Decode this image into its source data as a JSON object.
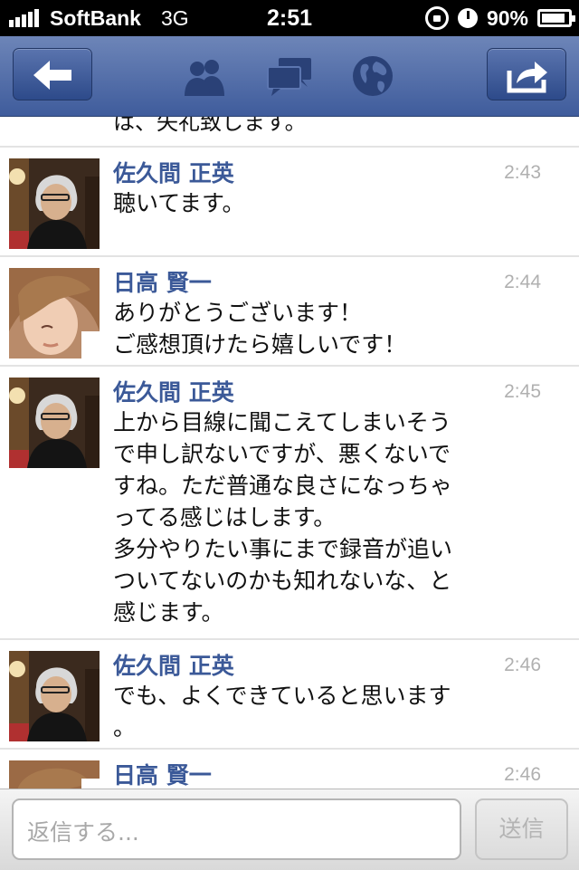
{
  "status_bar": {
    "carrier": "SoftBank",
    "network": "3G",
    "time": "2:51",
    "battery_percent": "90%",
    "battery_level": 0.9
  },
  "nav": {
    "back_icon": "back-arrow-icon",
    "friends_icon": "friends-icon",
    "messages_icon": "messages-icon",
    "globe_icon": "globe-icon",
    "share_icon": "share-icon"
  },
  "conversation": {
    "clipped_top_text": "は、失礼致します。",
    "messages": [
      {
        "sender": "佐久間 正英",
        "time": "2:43",
        "text": "聴いてます。"
      },
      {
        "sender": "日高 賢一",
        "time": "2:44",
        "text": "ありがとうございます！\nご感想頂けたら嬉しいです！"
      },
      {
        "sender": "佐久間 正英",
        "time": "2:45",
        "text": "上から目線に聞こえてしまいそう\nで申し訳ないですが、悪くないで\nすね。ただ普通な良さになっちゃ\nってる感じはします。\n多分やりたい事にまで録音が追い\nついてないのかも知れないな、と\n感じます。"
      },
      {
        "sender": "佐久間 正英",
        "time": "2:46",
        "text": "でも、よくできていると思います\n。"
      },
      {
        "sender": "日高 賢一",
        "time": "2:46",
        "text": ""
      }
    ]
  },
  "reply": {
    "placeholder": "返信する...",
    "send_label": "送信"
  },
  "colors": {
    "nav_blue": "#3f5c9c",
    "sender_blue": "#3b5998",
    "timestamp_gray": "#b0b0b0"
  }
}
